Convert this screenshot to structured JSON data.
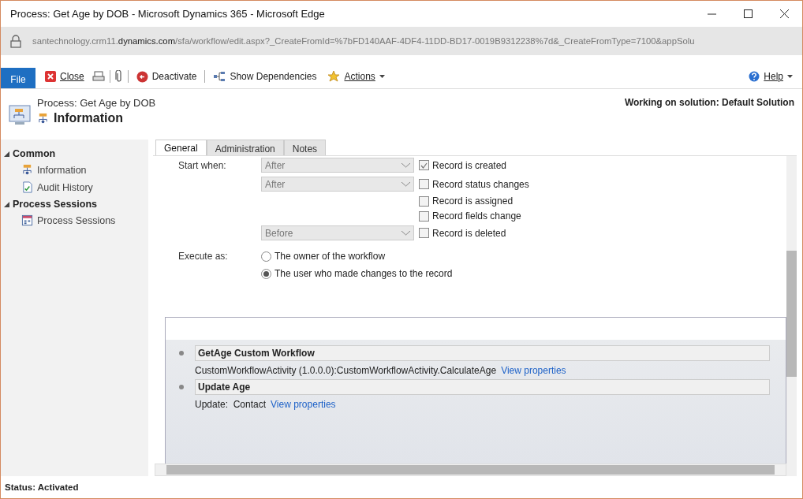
{
  "window": {
    "title": "Process: Get Age by DOB - Microsoft Dynamics 365 - Microsoft Edge"
  },
  "address_bar": {
    "url_host": "santechnology.crm11.",
    "url_domain": "dynamics.com",
    "url_path": "/sfa/workflow/edit.aspx?_CreateFromId=%7bFD140AAF-4DF4-11DD-BD17-0019B9312238%7d&_CreateFromType=7100&appSolu"
  },
  "toolbar": {
    "file": "File",
    "close": "Close",
    "deactivate": "Deactivate",
    "show_dependencies": "Show Dependencies",
    "actions": "Actions",
    "help": "Help"
  },
  "header": {
    "breadcrumb": "Process: Get Age by DOB",
    "title": "Information",
    "solution": "Working on solution: Default Solution"
  },
  "sidebar": {
    "groups": [
      {
        "label": "Common",
        "expanded": true,
        "items": [
          {
            "label": "Information",
            "kind": "workflow"
          },
          {
            "label": "Audit History",
            "kind": "audit"
          }
        ]
      },
      {
        "label": "Process Sessions",
        "expanded": true,
        "items": [
          {
            "label": "Process Sessions",
            "kind": "sessions"
          }
        ]
      }
    ]
  },
  "tabs": [
    {
      "label": "General",
      "selected": true
    },
    {
      "label": "Administration",
      "selected": false
    },
    {
      "label": "Notes",
      "selected": false
    }
  ],
  "form": {
    "start_when_label": "Start when:",
    "triggers": [
      {
        "dropdown": "After",
        "label": "Record is created",
        "checked": true
      },
      {
        "dropdown": "After",
        "label": "Record status changes",
        "checked": false
      },
      {
        "label": "Record is assigned",
        "checked": false
      },
      {
        "label": "Record fields change",
        "checked": false
      },
      {
        "dropdown": "Before",
        "label": "Record is deleted",
        "checked": false
      }
    ],
    "execute_as_label": "Execute as:",
    "execute_options": [
      {
        "label": "The owner of the workflow",
        "selected": false
      },
      {
        "label": "The user who made changes to the record",
        "selected": true
      }
    ]
  },
  "steps": [
    {
      "title": "GetAge Custom Workflow",
      "description": "CustomWorkflowActivity (1.0.0.0):CustomWorkflowActivity.CalculateAge",
      "link": "View properties"
    },
    {
      "title": "Update Age",
      "description": "Update:  Contact",
      "link": "View properties"
    }
  ],
  "status_bar": {
    "text": "Status: Activated"
  }
}
